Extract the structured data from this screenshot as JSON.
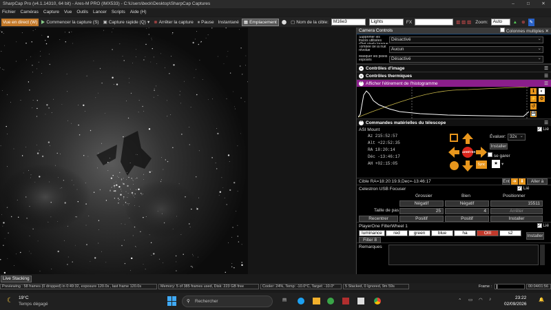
{
  "window": {
    "title": "SharpCap Pro (v4.1.14310, 64 bit) - Ares-M PRO (IMX533) - C:\\Users\\beck\\Desktop\\SharpCap Captures"
  },
  "menu": [
    "Fichier",
    "Caméras",
    "Capture",
    "Vue",
    "Outils",
    "Lancer",
    "Scripts",
    "Aide (H)"
  ],
  "toolbar": {
    "live_view": "Vue en direct (W)",
    "start_capture": "Commencer la capture (S)",
    "quick_capture": "Capture rapide (Q)",
    "stop_capture": "Arrêter la capture",
    "pause": "Pause",
    "snapshot": "Instantané",
    "placement": "Emplacement",
    "target_label": "Nom de la cible:",
    "target_value": "M16e3",
    "frame_type": "Lights",
    "fx_label": "FX",
    "zoom_label": "Zoom:",
    "zoom_value": "Auto"
  },
  "camera_controls": {
    "title": "Camera Controls",
    "multi_column": "Colonnes multiples",
    "row1_label": "Supprimer les traces utilisées d'hot pixels lorsque de la nuit",
    "row1_value": "Désactivé",
    "row2_label": "Tombée de la nuit révolue",
    "row2_value": "Aucun",
    "row3_label": "Masquer les pixels exposés",
    "row3_value": "Désactivé"
  },
  "sections": {
    "image_controls": "Contrôles d'image",
    "thermal_controls": "Contrôles thermiques",
    "histogram": "Afficher l'étirement de l'histogramme",
    "telescope": "Commandes matérielles du télescope"
  },
  "mount": {
    "name": "ASI Mount",
    "link": "Lié",
    "az": "Az   215:52:57",
    "alt": "Alt  +22:52:35",
    "ra": "RA   18:20:14",
    "dec": "Déc  -13:46:17",
    "ah": "AH   +02:15:05",
    "evaluate_label": "Évaluer:",
    "evaluate_value": "32x",
    "install": "Installer",
    "park": "se garer",
    "stop": "ARRÊTER",
    "sync": "Sync",
    "target": "Cible   RA=18:20:19.9,Dec=-13:46:17",
    "in": "Ent",
    "goto": "Aller à"
  },
  "focuser": {
    "name": "Celestron USB Focuser",
    "link": "Lié",
    "coarse": "Grossier",
    "fine": "Bien",
    "position": "Positionner",
    "negative": "Négatif",
    "position_value": "15511",
    "step_label": "Taille de pas",
    "step_coarse": "25",
    "step_fine": "4",
    "stop": "Arrêter",
    "recenter": "Recentrer",
    "positive": "Positif",
    "install": "Installer"
  },
  "filterwheel": {
    "name": "PlayerOne FilterWheel 1",
    "link": "Lié",
    "filters": [
      "luminance",
      "red",
      "green",
      "blue",
      "ha",
      "OIII",
      "s2"
    ],
    "selected_index": 5,
    "extra": "Filter 8",
    "install": "Installer"
  },
  "remarks_label": "Remarques",
  "live_stacking": "Live Stacking",
  "status": {
    "preview": "Previewing : 58 frames (0 dropped) in 0:49:32, exposure 120.0s , last frame 120.0s",
    "memory": "Memory: 5 of 385 frames used, Disk: 223 GB free",
    "cooler": "Cooler: 24%, Temp: -10.0°C, Target: -10.0°",
    "stacked": "5 Stacked, 0 Ignored, 9m 59s",
    "frame_label": "Frame :",
    "time": "00:04/01:56"
  },
  "taskbar": {
    "temp": "19°C",
    "weather": "Temps dégagé",
    "search": "Rechercher",
    "clock_time": "23:22",
    "clock_date": "02/09/2026"
  },
  "colors": {
    "accent_orange": "#e8961c",
    "histogram_purple": "#8b1e8b",
    "stop_red": "#d9241b"
  }
}
